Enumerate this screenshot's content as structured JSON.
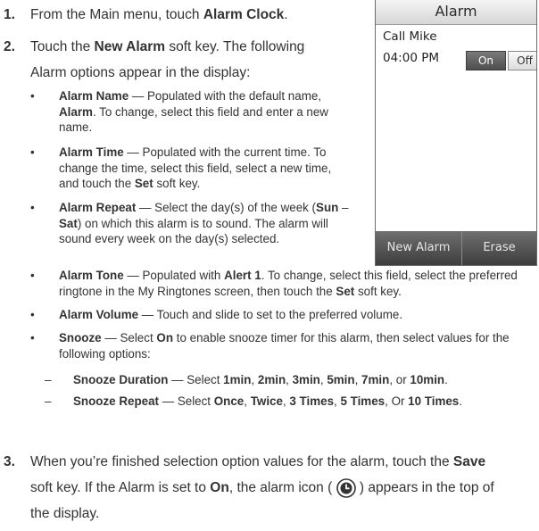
{
  "step1": {
    "number": "1.",
    "pre": "From the Main menu, touch ",
    "bold": "Alarm Clock",
    "post": "."
  },
  "step2": {
    "number": "2.",
    "line1_pre": "Touch the ",
    "line1_bold": "New Alarm",
    "line1_post": " soft key. The following",
    "line2": "Alarm options appear in the display:"
  },
  "bullets": {
    "name": {
      "bold": "Alarm Name",
      "t1": " — Populated with the default name,",
      "bold2": "Alarm",
      "t2": ". To change, select this field and enter a new",
      "t3": "name."
    },
    "time": {
      "bold": "Alarm Time",
      "t1": " — Populated with the current time. To",
      "t2": "change the time, select this field, select a new time,",
      "t3": "and touch the ",
      "bold2": "Set",
      "t4": " soft key."
    },
    "repeat": {
      "bold": "Alarm Repeat",
      "t1": " — Select the day(s) of the week (",
      "bold2": "Sun",
      "t2": " –",
      "bold3": "Sat",
      "t3": ") on which this alarm is to sound. The alarm will",
      "t4": "sound every week on the day(s) selected."
    },
    "tone": {
      "bold": "Alarm Tone",
      "t1": " — Populated with ",
      "bold2": "Alert 1",
      "t2": ". To change, select this field, select the preferred",
      "t3": "ringtone in the My Ringtones screen, then touch the ",
      "bold3": "Set",
      "t4": " soft key."
    },
    "volume": {
      "bold": "Alarm Volume",
      "t1": " — Touch and slide to set to the preferred volume."
    },
    "snooze": {
      "bold": "Snooze",
      "t1": " — Select ",
      "bold2": "On",
      "t2": " to enable snooze timer for this alarm, then select values for the",
      "t3": "following options:"
    },
    "duration": {
      "bold": "Snooze Duration",
      "t1": " — Select ",
      "v1": "1min",
      "s1": ", ",
      "v2": "2min",
      "s2": ", ",
      "v3": "3min",
      "s3": ", ",
      "v4": "5min",
      "s4": ", ",
      "v5": "7min",
      "s5": ", or ",
      "v6": "10min",
      "s6": "."
    },
    "snooze_repeat": {
      "bold": "Snooze Repeat",
      "t1": " — Select ",
      "v1": "Once",
      "s1": ", ",
      "v2": "Twice",
      "s2": ", ",
      "v3": "3 Times",
      "s3": ", ",
      "v4": "5 Times",
      "s4": ", Or ",
      "v5": "10 Times",
      "s5": "."
    }
  },
  "step3": {
    "number": "3.",
    "l1_pre": "When you’re finished selection option values for the alarm, touch the ",
    "l1_bold": "Save",
    "l2_pre": "soft key. If the Alarm is set to ",
    "l2_bold": "On",
    "l2_mid": ", the alarm icon ( ",
    "l2_post": " ) appears in the top of",
    "l3": "the display."
  },
  "phone": {
    "title": "Alarm",
    "alarm_name": "Call Mike",
    "alarm_time": "04:00 PM",
    "on_label": "On",
    "off_label": "Off",
    "softkey_left": "New Alarm",
    "softkey_right": "Erase",
    "icons": [
      "alarm-clock-icon"
    ]
  }
}
